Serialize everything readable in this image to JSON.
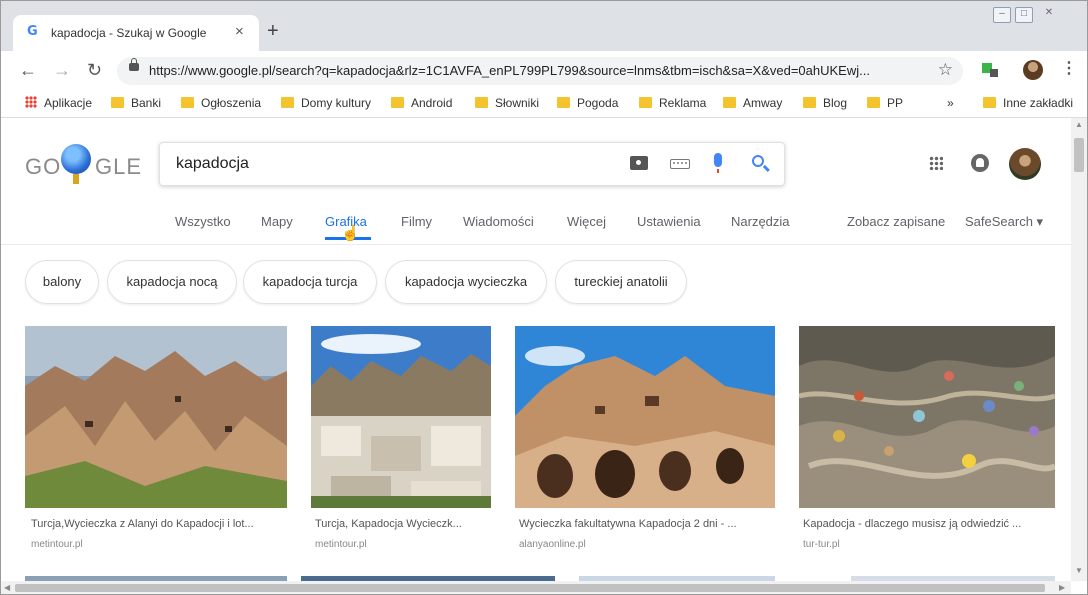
{
  "browser": {
    "tab_title": "kapadocja - Szukaj w Google",
    "tab_favicon": "G",
    "tab_close": "×",
    "new_tab": "+",
    "url_display": "https://www.google.pl/search?q=kapadocja&rlz=1C1AVFA_enPL799PL799&source=lnms&tbm=isch&sa=X&ved=0ahUKEwj..."
  },
  "bookmarks": [
    "Aplikacje",
    "Banki",
    "Ogłoszenia",
    "Domy kultury",
    "Android",
    "Słowniki",
    "Pogoda",
    "Reklama",
    "Amway",
    "Blog",
    "PP"
  ],
  "bookmarks_overflow": "»",
  "bookmarks_other": "Inne zakładki",
  "search": {
    "logo_left": "GO",
    "logo_right": "GLE",
    "query": "kapadocja"
  },
  "tabs": [
    "Wszystko",
    "Mapy",
    "Grafika",
    "Filmy",
    "Wiadomości",
    "Więcej",
    "Ustawienia",
    "Narzędzia"
  ],
  "active_tab": "Grafika",
  "right_links": {
    "saved": "Zobacz zapisane",
    "safesearch": "SafeSearch ▾"
  },
  "chips": [
    "balony",
    "kapadocja nocą",
    "kapadocja turcja",
    "kapadocja wycieczka",
    "tureckiej anatolii"
  ],
  "results": [
    {
      "caption": "Turcja,Wycieczka z Alanyi do Kapadocji i lot...",
      "source": "metintour.pl"
    },
    {
      "caption": "Turcja, Kapadocja Wycieczk...",
      "source": "metintour.pl"
    },
    {
      "caption": "Wycieczka fakultatywna Kapadocja 2 dni - ...",
      "source": "alanyaonline.pl"
    },
    {
      "caption": "Kapadocja - dlaczego musisz ją odwiedzić ...",
      "source": "tur-tur.pl"
    }
  ],
  "colors": {
    "accent": "#1a73e8",
    "chrome": "#dee1e6"
  }
}
